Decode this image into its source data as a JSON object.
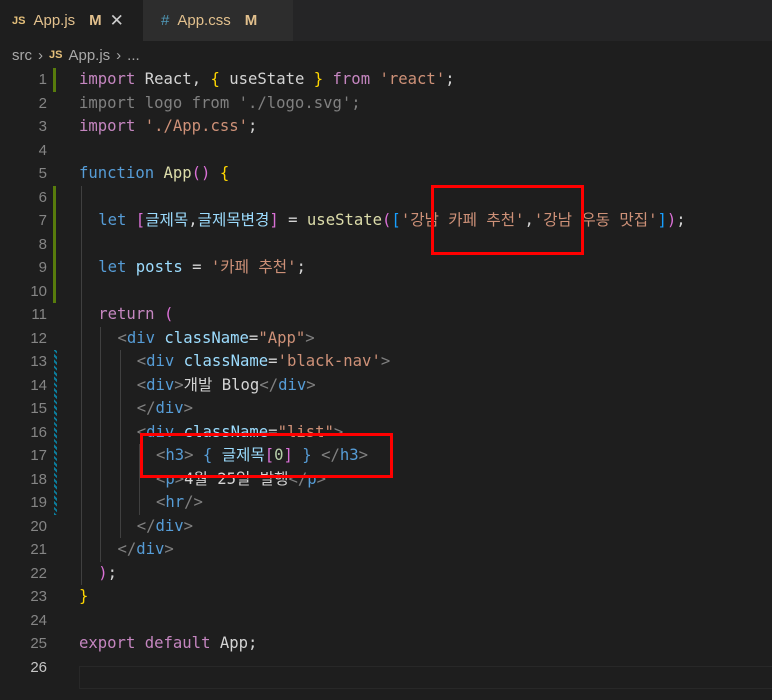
{
  "tabs": [
    {
      "icon": "JS",
      "name": "App.js",
      "status": "M",
      "close": "✕"
    },
    {
      "icon": "#",
      "name": "App.css",
      "status": "M"
    }
  ],
  "breadcrumb": {
    "folder": "src",
    "file_icon": "JS",
    "file": "App.js",
    "rest": "..."
  },
  "line_numbers": [
    "1",
    "2",
    "3",
    "4",
    "5",
    "6",
    "7",
    "8",
    "9",
    "10",
    "11",
    "12",
    "13",
    "14",
    "15",
    "16",
    "17",
    "18",
    "19",
    "20",
    "21",
    "22",
    "23",
    "24",
    "25",
    "26"
  ],
  "code": {
    "l1": [
      "import",
      " ",
      "React",
      ", ",
      "{",
      " ",
      "useState",
      " ",
      "}",
      " ",
      "from",
      " ",
      "'react'",
      ";"
    ],
    "l2": [
      "import logo from './logo.svg';"
    ],
    "l3": [
      "import",
      " ",
      "'./App.css'",
      ";"
    ],
    "l5": [
      "function",
      " ",
      "App",
      "()",
      " ",
      "{"
    ],
    "l7": [
      "let",
      " ",
      "[",
      "글제목",
      ",",
      "글제목변경",
      "]",
      " = ",
      "useState",
      "(",
      "[",
      "'강남 카페 추천'",
      ",",
      "'강남 우동 맛집'",
      "]",
      ")",
      ";"
    ],
    "l9": [
      "let",
      " ",
      "posts",
      " = ",
      "'카페 추천'",
      ";"
    ],
    "l11": [
      "return",
      " ",
      "("
    ],
    "l12": [
      "<",
      "div",
      " ",
      "className",
      "=",
      "\"App\"",
      ">"
    ],
    "l13": [
      "<",
      "div",
      " ",
      "className",
      "=",
      "'black-nav'",
      ">"
    ],
    "l14": [
      "<",
      "div",
      ">",
      "개발 Blog",
      "</",
      "div",
      ">"
    ],
    "l15": [
      "</",
      "div",
      ">"
    ],
    "l16": [
      "<",
      "div",
      " ",
      "className",
      "=",
      "\"list\"",
      ">"
    ],
    "l17": [
      "<",
      "h3",
      "> ",
      "{",
      " ",
      "글제목",
      "[",
      "0",
      "]",
      " ",
      "}",
      " </",
      "h3",
      ">"
    ],
    "l18": [
      "<",
      "p",
      ">",
      "4월 25일 발행",
      "</",
      "p",
      ">"
    ],
    "l19": [
      "<",
      "hr",
      "/>"
    ],
    "l20": [
      "</",
      "div",
      ">"
    ],
    "l21": [
      "</",
      "div",
      ">"
    ],
    "l22": [
      ")",
      ";"
    ],
    "l23": [
      "}"
    ],
    "l25": [
      "export",
      " ",
      "default",
      " ",
      "App",
      ";"
    ]
  }
}
